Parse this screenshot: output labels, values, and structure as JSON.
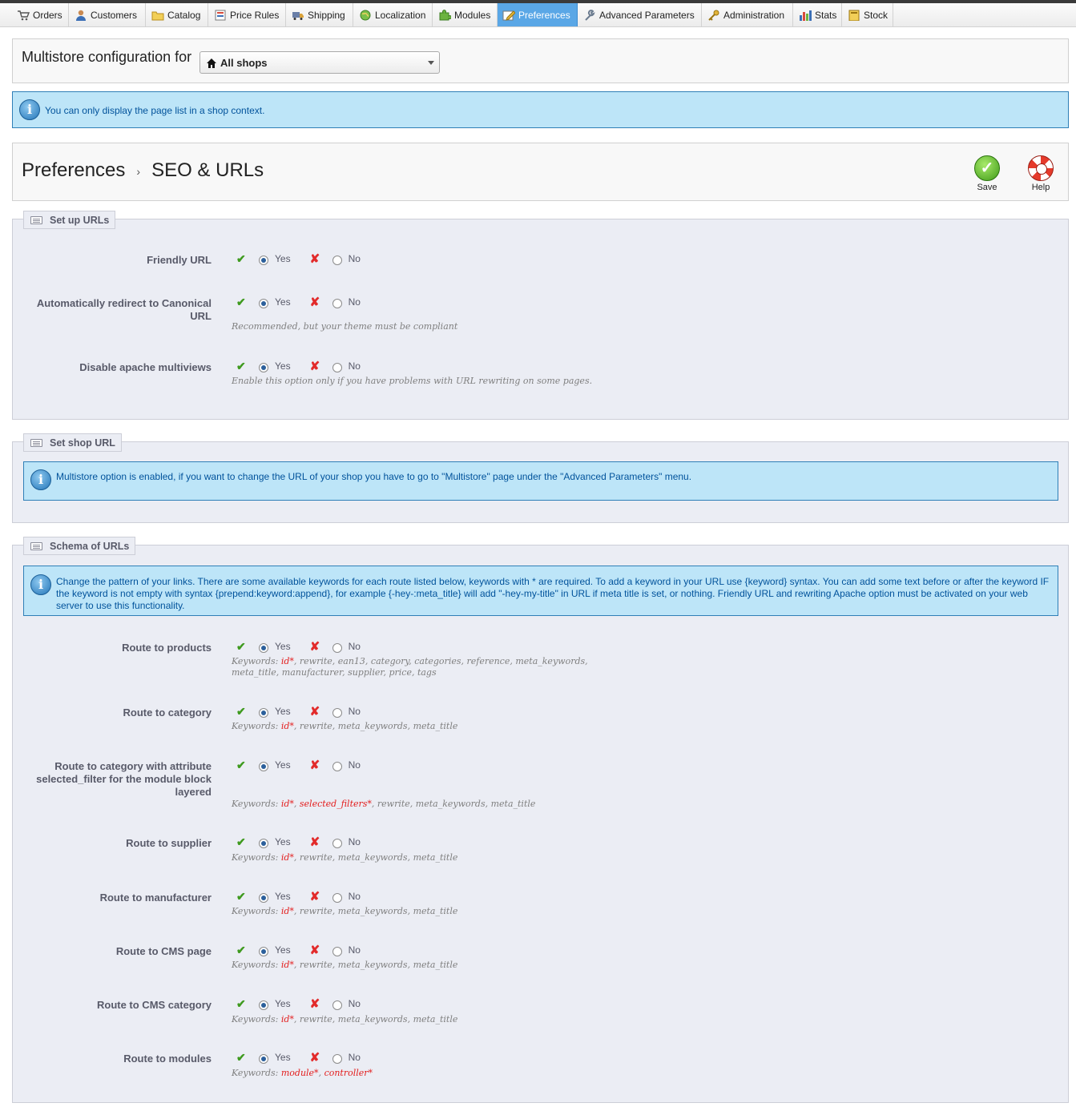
{
  "menu": {
    "items": [
      {
        "label": "Orders",
        "icon": "cart-icon"
      },
      {
        "label": "Customers",
        "icon": "user-icon"
      },
      {
        "label": "Catalog",
        "icon": "folder-icon"
      },
      {
        "label": "Price Rules",
        "icon": "price-rules-icon"
      },
      {
        "label": "Shipping",
        "icon": "truck-icon"
      },
      {
        "label": "Localization",
        "icon": "globe-icon"
      },
      {
        "label": "Modules",
        "icon": "puzzle-icon"
      },
      {
        "label": "Preferences",
        "icon": "preferences-icon",
        "active": true
      },
      {
        "label": "Advanced Parameters",
        "icon": "wrench-icon"
      },
      {
        "label": "Administration",
        "icon": "key-icon"
      },
      {
        "label": "Stats",
        "icon": "bar-chart-icon"
      },
      {
        "label": "Stock",
        "icon": "stock-icon"
      }
    ]
  },
  "multistore": {
    "label": "Multistore configuration for",
    "selected": "All shops"
  },
  "context_notice": "You can only display the page list in a shop context.",
  "toolbar": {
    "breadcrumb_parent": "Preferences",
    "breadcrumb_sep": "›",
    "breadcrumb_current": "SEO & URLs",
    "save_label": "Save",
    "help_label": "Help"
  },
  "common": {
    "yes": "Yes",
    "no": "No"
  },
  "setup_urls": {
    "legend": "Set up URLs",
    "rows": [
      {
        "label": "Friendly URL",
        "value": "Yes"
      },
      {
        "label": "Automatically redirect to Canonical URL",
        "value": "Yes",
        "hint": "Recommended, but your theme must be compliant"
      },
      {
        "label": "Disable apache multiviews",
        "value": "Yes",
        "hint": "Enable this option only if you have problems with URL rewriting on some pages."
      }
    ]
  },
  "shop_url": {
    "legend": "Set shop URL",
    "notice": "Multistore option is enabled, if you want to change the URL of your shop you have to go to \"Multistore\" page under the \"Advanced Parameters\" menu."
  },
  "schema": {
    "legend": "Schema of URLs",
    "notice": "Change the pattern of your links. There are some available keywords for each route listed below, keywords with * are required. To add a keyword in your URL use {keyword} syntax. You can add some text before or after the keyword IF the keyword is not empty with syntax {prepend:keyword:append}, for example {-hey-:meta_title} will add \"-hey-my-title\" in URL if meta title is set, or nothing. Friendly URL and rewriting Apache option must be activated on your web server to use this functionality.",
    "keywords_prefix": "Keywords:",
    "rows": [
      {
        "label": "Route to products",
        "value": "Yes",
        "required": "id*",
        "rest": ", rewrite, ean13, category, categories, reference, meta_keywords, meta_title, manufacturer, supplier, price, tags"
      },
      {
        "label": "Route to category",
        "value": "Yes",
        "required": "id*",
        "rest": ", rewrite, meta_keywords, meta_title"
      },
      {
        "label": "Route to category with attribute selected_filter for the module block layered",
        "value": "Yes",
        "required": "id*",
        "required2": "selected_filters*",
        "rest": ", rewrite, meta_keywords, meta_title"
      },
      {
        "label": "Route to supplier",
        "value": "Yes",
        "required": "id*",
        "rest": ", rewrite, meta_keywords, meta_title"
      },
      {
        "label": "Route to manufacturer",
        "value": "Yes",
        "required": "id*",
        "rest": ", rewrite, meta_keywords, meta_title"
      },
      {
        "label": "Route to CMS page",
        "value": "Yes",
        "required": "id*",
        "rest": ", rewrite, meta_keywords, meta_title"
      },
      {
        "label": "Route to CMS category",
        "value": "Yes",
        "required": "id*",
        "rest": ", rewrite, meta_keywords, meta_title"
      },
      {
        "label": "Route to modules",
        "value": "Yes",
        "required": "module*",
        "required2": "controller*",
        "rest": ""
      }
    ]
  },
  "colors": {
    "active_tab": "#5aa7e6",
    "info_bg": "#bde5f8",
    "info_border": "#2f7fb7",
    "fieldset_bg": "#ebedf4",
    "required_keyword": "#e31d1d",
    "yes_icon": "#3e9a1e",
    "no_icon": "#e22b2b"
  }
}
